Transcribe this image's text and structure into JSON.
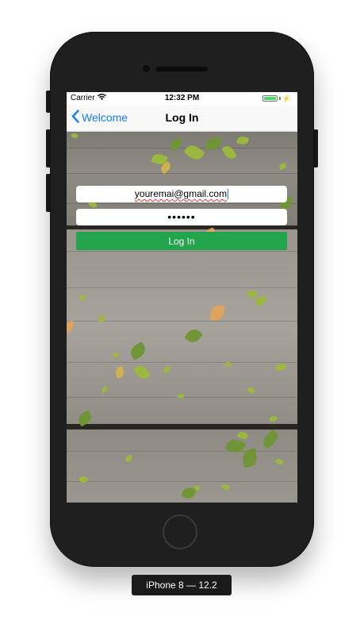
{
  "status_bar": {
    "carrier": "Carrier",
    "time": "12:32 PM",
    "battery_level": 1.0,
    "charging_symbol": "⚡"
  },
  "nav": {
    "back_label": "Welcome",
    "title": "Log In"
  },
  "form": {
    "email_value": "youremai@gmail.com",
    "password_value": "••••••",
    "login_label": "Log In"
  },
  "simulator": {
    "device_label": "iPhone 8 — 12.2"
  },
  "colors": {
    "accent": "#147efb",
    "login_button": "#22a44a",
    "battery": "#4cd964"
  },
  "icons": {
    "wifi": "wifi-icon",
    "battery": "battery-icon",
    "back": "chevron-left-icon"
  }
}
